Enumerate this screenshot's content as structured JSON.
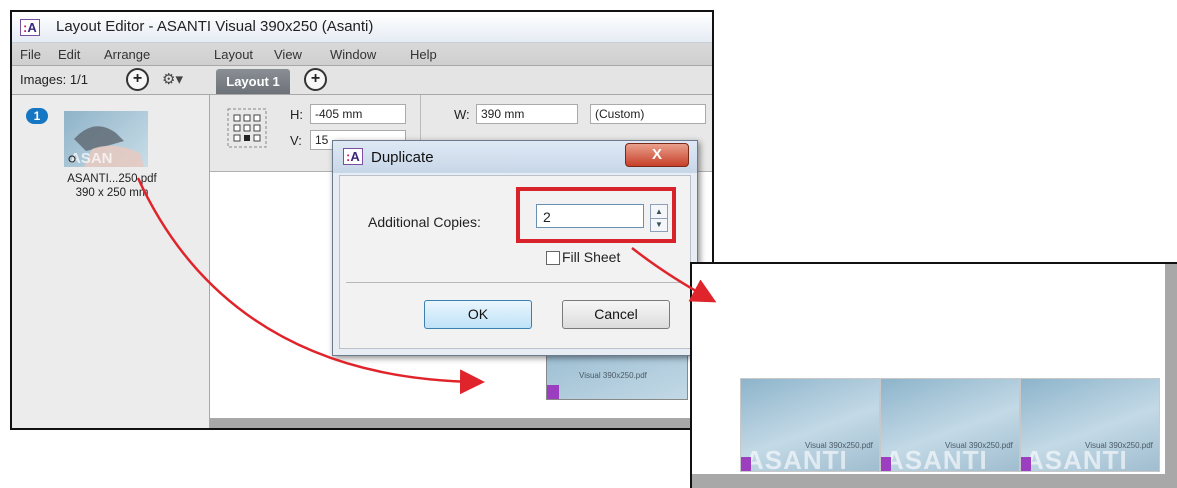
{
  "window": {
    "title": "Layout Editor - ASANTI Visual 390x250 (Asanti)",
    "logo_text": "A",
    "menu": [
      "File",
      "Edit",
      "Arrange",
      "Layout",
      "View",
      "Window",
      "Help"
    ]
  },
  "toolbar": {
    "images_label": "Images: 1/1",
    "add_symbol": "+",
    "gear_symbol": "⚙▾",
    "layout_tab": "Layout 1"
  },
  "left_panel": {
    "badge": "1",
    "file_name": "ASANTI...250.pdf",
    "file_size": "390 x 250 mm"
  },
  "props": {
    "h_label": "H:",
    "h_value": "-405 mm",
    "v_label": "V:",
    "v_value": "15",
    "w_label": "W:",
    "w_value": "390 mm",
    "preset": "(Custom)"
  },
  "dialog": {
    "title": "Duplicate",
    "close_symbol": "X",
    "copies_label": "Additional Copies:",
    "copies_value": "2",
    "fill_sheet_label": "Fill Sheet",
    "ok_label": "OK",
    "cancel_label": "Cancel"
  },
  "result": {
    "tile_caption": "Visual 390x250.pdf",
    "tile_logo": "ASANTI"
  },
  "colors": {
    "highlight": "#d9232b",
    "arrow": "#e0242b",
    "badge": "#1577c3",
    "tab": "#6d7278"
  }
}
